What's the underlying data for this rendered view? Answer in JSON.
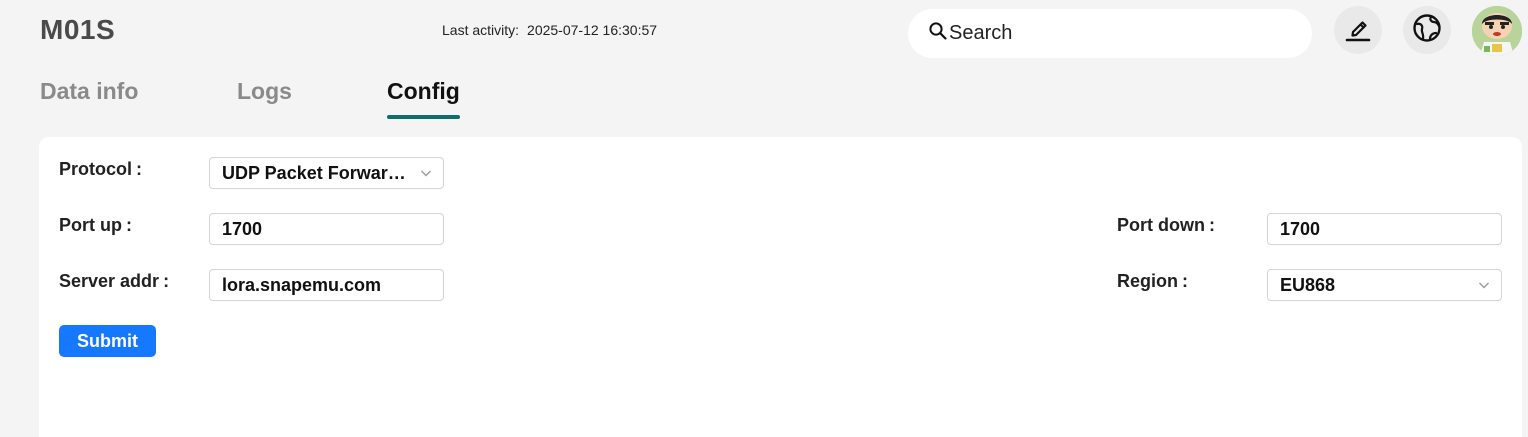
{
  "header": {
    "device_name": "M01S",
    "last_activity_label": "Last activity:",
    "last_activity_value": "2025-07-12 16:30:57",
    "search_placeholder": "Search",
    "icons": [
      "search-icon",
      "edit-icon",
      "language-icon",
      "user-avatar"
    ]
  },
  "tabs": [
    {
      "label": "Data info",
      "active": false
    },
    {
      "label": "Logs",
      "active": false
    },
    {
      "label": "Config",
      "active": true
    }
  ],
  "form": {
    "protocol": {
      "label": "Protocol",
      "colon": ":",
      "value": "UDP Packet Forwarder"
    },
    "port_up": {
      "label": "Port up",
      "colon": ":",
      "value": "1700"
    },
    "server_addr": {
      "label": "Server addr",
      "colon": ":",
      "value": "lora.snapemu.com"
    },
    "port_down": {
      "label": "Port down",
      "colon": ":",
      "value": "1700"
    },
    "region": {
      "label": "Region",
      "colon": ":",
      "value": "EU868"
    },
    "submit_label": "Submit"
  },
  "colors": {
    "accent": "#0d6f6a",
    "primary_button": "#1677ff",
    "background": "#f4f4f4"
  }
}
